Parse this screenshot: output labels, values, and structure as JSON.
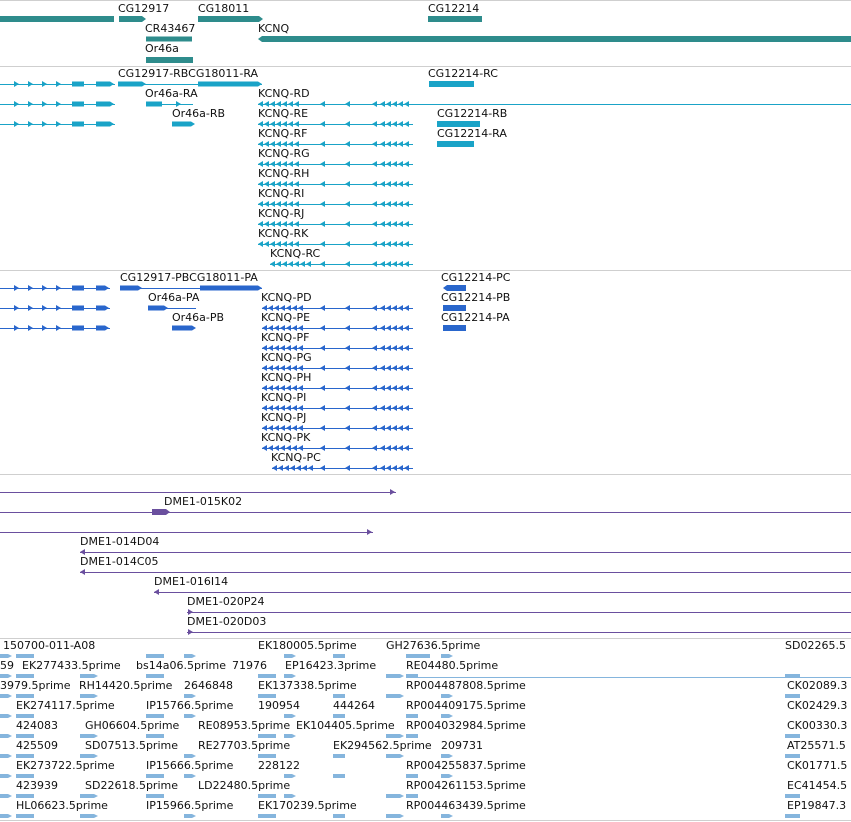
{
  "colors": {
    "gene": "#2e8c8c",
    "transcript": "#1aa3c7",
    "protein": "#2966cc",
    "clone": "#6a4f9e",
    "est": "#85b5dd",
    "separator": "#cfcfcf"
  },
  "tracks": {
    "genes": [
      {
        "label": "CG12917"
      },
      {
        "label": "CG18011"
      },
      {
        "label": "CG12214"
      },
      {
        "label": "CR43467"
      },
      {
        "label": "KCNQ"
      },
      {
        "label": "Or46a"
      }
    ],
    "transcripts": [
      {
        "label": "CG12917-RBCG18011-RA"
      },
      {
        "label": "CG12214-RC"
      },
      {
        "label": "Or46a-RA"
      },
      {
        "label": "KCNQ-RD"
      },
      {
        "label": "Or46a-RB"
      },
      {
        "label": "KCNQ-RE"
      },
      {
        "label": "CG12214-RB"
      },
      {
        "label": "KCNQ-RF"
      },
      {
        "label": "CG12214-RA"
      },
      {
        "label": "KCNQ-RG"
      },
      {
        "label": "KCNQ-RH"
      },
      {
        "label": "KCNQ-RI"
      },
      {
        "label": "KCNQ-RJ"
      },
      {
        "label": "KCNQ-RK"
      },
      {
        "label": "KCNQ-RC"
      }
    ],
    "proteins": [
      {
        "label": "CG12917-PBCG18011-PA"
      },
      {
        "label": "CG12214-PC"
      },
      {
        "label": "Or46a-PA"
      },
      {
        "label": "KCNQ-PD"
      },
      {
        "label": "CG12214-PB"
      },
      {
        "label": "Or46a-PB"
      },
      {
        "label": "KCNQ-PE"
      },
      {
        "label": "CG12214-PA"
      },
      {
        "label": "KCNQ-PF"
      },
      {
        "label": "KCNQ-PG"
      },
      {
        "label": "KCNQ-PH"
      },
      {
        "label": "KCNQ-PI"
      },
      {
        "label": "KCNQ-PJ"
      },
      {
        "label": "KCNQ-PK"
      },
      {
        "label": "KCNQ-PC"
      }
    ],
    "clones": [
      {
        "label": "DME1-015K02"
      },
      {
        "label": "DME1-014D04"
      },
      {
        "label": "DME1-014C05"
      },
      {
        "label": "DME1-016I14"
      },
      {
        "label": "DME1-020P24"
      },
      {
        "label": "DME1-020D03"
      }
    ],
    "ests": [
      {
        "label": "150700-011-A08"
      },
      {
        "label": "EK180005.5prime"
      },
      {
        "label": "GH27636.5prime"
      },
      {
        "label": "SD02265.5"
      },
      {
        "label": "59"
      },
      {
        "label": "EK277433.5prime"
      },
      {
        "label": "bs14a06.5prime"
      },
      {
        "label": "71976"
      },
      {
        "label": "EP16423.3prime"
      },
      {
        "label": "RE04480.5prime"
      },
      {
        "label": "3979.5prime"
      },
      {
        "label": "RH14420.5prime"
      },
      {
        "label": "2646848"
      },
      {
        "label": "EK137338.5prime"
      },
      {
        "label": "RP004487808.5prime"
      },
      {
        "label": "CK02089.3"
      },
      {
        "label": "EK274117.5prime"
      },
      {
        "label": "IP15766.5prime"
      },
      {
        "label": "190954"
      },
      {
        "label": "444264"
      },
      {
        "label": "RP004409175.5prime"
      },
      {
        "label": "CK02429.3"
      },
      {
        "label": "424083"
      },
      {
        "label": "GH06604.5prime"
      },
      {
        "label": "RE08953.5prime"
      },
      {
        "label": "EK104405.5prime"
      },
      {
        "label": "RP004032984.5prime"
      },
      {
        "label": "CK00330.3"
      },
      {
        "label": "425509"
      },
      {
        "label": "SD07513.5prime"
      },
      {
        "label": "RE27703.5prime"
      },
      {
        "label": "EK294562.5prime"
      },
      {
        "label": "209731"
      },
      {
        "label": "AT25571.5"
      },
      {
        "label": "EK273722.5prime"
      },
      {
        "label": "IP15666.5prime"
      },
      {
        "label": "228122"
      },
      {
        "label": "RP004255837.5prime"
      },
      {
        "label": "CK01771.5"
      },
      {
        "label": "423939"
      },
      {
        "label": "SD22618.5prime"
      },
      {
        "label": "LD22480.5prime"
      },
      {
        "label": "RP004261153.5prime"
      },
      {
        "label": "EC41454.5"
      },
      {
        "label": "HL06623.5prime"
      },
      {
        "label": "IP15966.5prime"
      },
      {
        "label": "EK170239.5prime"
      },
      {
        "label": "RP004463439.5prime"
      },
      {
        "label": "EP19847.3"
      }
    ]
  }
}
